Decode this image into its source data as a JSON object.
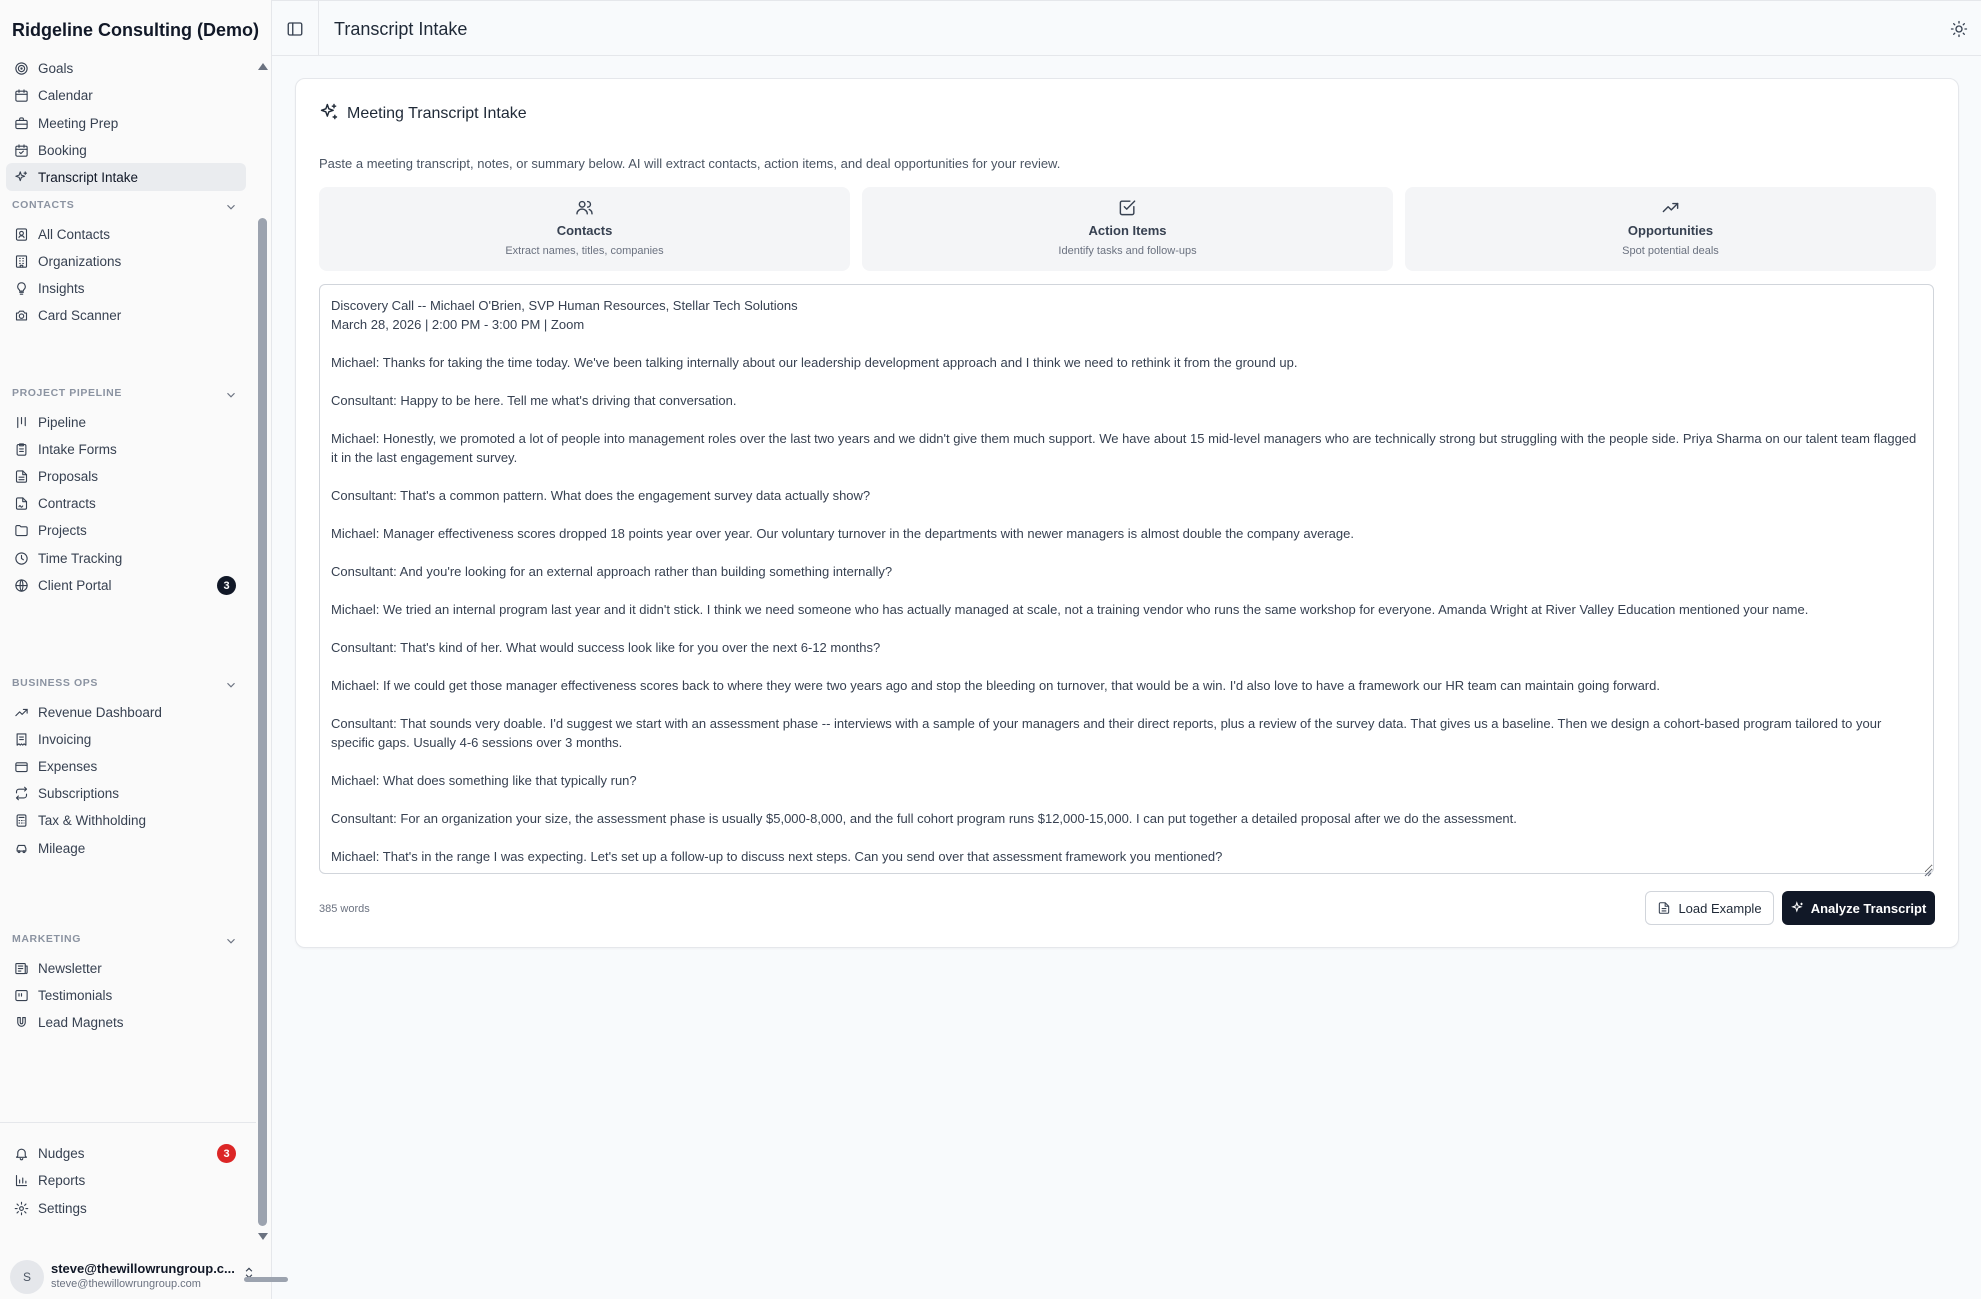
{
  "app": {
    "brand": "Ridgeline Consulting (Demo)"
  },
  "sidebar": {
    "top_items": [
      {
        "label": "Goals",
        "icon": "target-icon"
      },
      {
        "label": "Calendar",
        "icon": "calendar-icon"
      },
      {
        "label": "Meeting Prep",
        "icon": "briefcase-icon"
      },
      {
        "label": "Booking",
        "icon": "calendar-check-icon"
      },
      {
        "label": "Transcript Intake",
        "icon": "sparkles-icon",
        "active": true
      }
    ],
    "sections": [
      {
        "label": "CONTACTS",
        "items": [
          {
            "label": "All Contacts",
            "icon": "contact-book-icon"
          },
          {
            "label": "Organizations",
            "icon": "building-icon"
          },
          {
            "label": "Insights",
            "icon": "lightbulb-icon"
          },
          {
            "label": "Card Scanner",
            "icon": "camera-icon"
          }
        ]
      },
      {
        "label": "PROJECT PIPELINE",
        "items": [
          {
            "label": "Pipeline",
            "icon": "kanban-icon"
          },
          {
            "label": "Intake Forms",
            "icon": "clipboard-icon"
          },
          {
            "label": "Proposals",
            "icon": "file-text-icon"
          },
          {
            "label": "Contracts",
            "icon": "file-signature-icon"
          },
          {
            "label": "Projects",
            "icon": "folder-icon"
          },
          {
            "label": "Time Tracking",
            "icon": "clock-icon"
          },
          {
            "label": "Client Portal",
            "icon": "globe-icon",
            "badge": "3"
          }
        ]
      },
      {
        "label": "BUSINESS OPS",
        "items": [
          {
            "label": "Revenue Dashboard",
            "icon": "trending-up-icon"
          },
          {
            "label": "Invoicing",
            "icon": "receipt-icon"
          },
          {
            "label": "Expenses",
            "icon": "wallet-icon"
          },
          {
            "label": "Subscriptions",
            "icon": "repeat-icon"
          },
          {
            "label": "Tax & Withholding",
            "icon": "calculator-icon"
          },
          {
            "label": "Mileage",
            "icon": "car-icon"
          }
        ]
      },
      {
        "label": "MARKETING",
        "items": [
          {
            "label": "Newsletter",
            "icon": "newspaper-icon"
          },
          {
            "label": "Testimonials",
            "icon": "quote-icon"
          },
          {
            "label": "Lead Magnets",
            "icon": "magnet-icon"
          }
        ]
      }
    ],
    "bottom_items": [
      {
        "label": "Nudges",
        "icon": "bell-icon",
        "badge": "3"
      },
      {
        "label": "Reports",
        "icon": "bar-chart-icon"
      },
      {
        "label": "Settings",
        "icon": "gear-icon"
      }
    ],
    "user": {
      "initial": "S",
      "name": "steve@thewillowrungroup.c...",
      "email": "steve@thewillowrungroup.com"
    }
  },
  "colors": {
    "badge_dark": "#111827",
    "badge_red": "#dc2626",
    "primary": "#111827"
  },
  "header": {
    "title": "Transcript Intake"
  },
  "main": {
    "card_title": "Meeting Transcript Intake",
    "description": "Paste a meeting transcript, notes, or summary below. AI will extract contacts, action items, and deal opportunities for your review.",
    "features": [
      {
        "title": "Contacts",
        "desc": "Extract names, titles, companies",
        "icon": "users-icon"
      },
      {
        "title": "Action Items",
        "desc": "Identify tasks and follow-ups",
        "icon": "check-square-icon"
      },
      {
        "title": "Opportunities",
        "desc": "Spot potential deals",
        "icon": "trending-up-icon"
      }
    ],
    "transcript": "Discovery Call -- Michael O'Brien, SVP Human Resources, Stellar Tech Solutions\nMarch 28, 2026 | 2:00 PM - 3:00 PM | Zoom\n\nMichael: Thanks for taking the time today. We've been talking internally about our leadership development approach and I think we need to rethink it from the ground up.\n\nConsultant: Happy to be here. Tell me what's driving that conversation.\n\nMichael: Honestly, we promoted a lot of people into management roles over the last two years and we didn't give them much support. We have about 15 mid-level managers who are technically strong but struggling with the people side. Priya Sharma on our talent team flagged it in the last engagement survey.\n\nConsultant: That's a common pattern. What does the engagement survey data actually show?\n\nMichael: Manager effectiveness scores dropped 18 points year over year. Our voluntary turnover in the departments with newer managers is almost double the company average.\n\nConsultant: And you're looking for an external approach rather than building something internally?\n\nMichael: We tried an internal program last year and it didn't stick. I think we need someone who has actually managed at scale, not a training vendor who runs the same workshop for everyone. Amanda Wright at River Valley Education mentioned your name.\n\nConsultant: That's kind of her. What would success look like for you over the next 6-12 months?\n\nMichael: If we could get those manager effectiveness scores back to where they were two years ago and stop the bleeding on turnover, that would be a win. I'd also love to have a framework our HR team can maintain going forward.\n\nConsultant: That sounds very doable. I'd suggest we start with an assessment phase -- interviews with a sample of your managers and their direct reports, plus a review of the survey data. That gives us a baseline. Then we design a cohort-based program tailored to your specific gaps. Usually 4-6 sessions over 3 months.\n\nMichael: What does something like that typically run?\n\nConsultant: For an organization your size, the assessment phase is usually $5,000-8,000, and the full cohort program runs $12,000-15,000. I can put together a detailed proposal after we do the assessment.\n\nMichael: That's in the range I was expecting. Let's set up a follow-up to discuss next steps. Can you send over that assessment framework you mentioned?",
    "word_count": "385 words",
    "load_example_label": "Load Example",
    "analyze_label": "Analyze Transcript"
  }
}
